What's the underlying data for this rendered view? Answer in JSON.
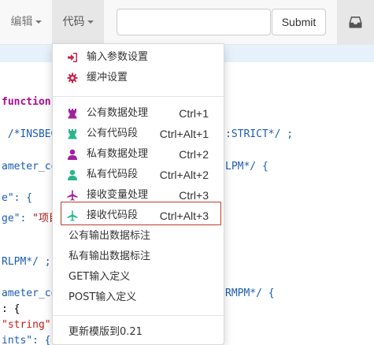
{
  "navbar": {
    "edit_label": "编辑",
    "code_label": "代码",
    "search_value": "",
    "submit_label": "Submit",
    "inbox_icon": "inbox-icon"
  },
  "editor": {
    "lines": [
      {
        "prefix": "",
        "kw": "function",
        "rest": ""
      },
      {
        "comment": " /*INSBEG",
        "tail": ":STRICT*/ ;"
      },
      {
        "prop": "ameter_co",
        "tail": "LPM*/ {"
      },
      {
        "prop": "e\": {"
      },
      {
        "prop": "ge\": ",
        "str": "\"项目"
      },
      {
        "comment": "RLPM*/ ;"
      },
      {
        "prop": "ameter_co",
        "tail": "RMPM*/ {"
      },
      {
        "text": ": {"
      },
      {
        "str": "\"string\""
      },
      {
        "prop": "ints\": {"
      }
    ]
  },
  "menu": {
    "items": [
      {
        "label": "输入参数设置",
        "shortcut": "",
        "icon": "sign-in-icon",
        "color": "#c7254e"
      },
      {
        "label": "缓冲设置",
        "shortcut": "",
        "icon": "gear-icon",
        "color": "#c7254e"
      },
      {
        "label": "公有数据处理",
        "shortcut": "Ctrl+1",
        "icon": "rook-icon",
        "color": "#a020a0"
      },
      {
        "label": "公有代码段",
        "shortcut": "Ctrl+Alt+1",
        "icon": "rook-icon",
        "color": "#2ab68a"
      },
      {
        "label": "私有数据处理",
        "shortcut": "Ctrl+2",
        "icon": "user-icon",
        "color": "#a020a0"
      },
      {
        "label": "私有代码段",
        "shortcut": "Ctrl+Alt+2",
        "icon": "user-icon",
        "color": "#2ab68a"
      },
      {
        "label": "接收变量处理",
        "shortcut": "Ctrl+3",
        "icon": "plane-icon",
        "color": "#a020a0"
      },
      {
        "label": "接收代码段",
        "shortcut": "Ctrl+Alt+3",
        "icon": "plane-icon",
        "color": "#2ab68a"
      },
      {
        "label": "公有输出数据标注",
        "shortcut": "",
        "icon": "",
        "color": ""
      },
      {
        "label": "私有输出数据标注",
        "shortcut": "",
        "icon": "",
        "color": ""
      },
      {
        "label": "GET输入定义",
        "shortcut": "",
        "icon": "",
        "color": ""
      },
      {
        "label": "POST输入定义",
        "shortcut": "",
        "icon": "",
        "color": ""
      },
      {
        "label": "更新模版到0.21",
        "shortcut": "",
        "icon": "",
        "color": ""
      }
    ]
  }
}
